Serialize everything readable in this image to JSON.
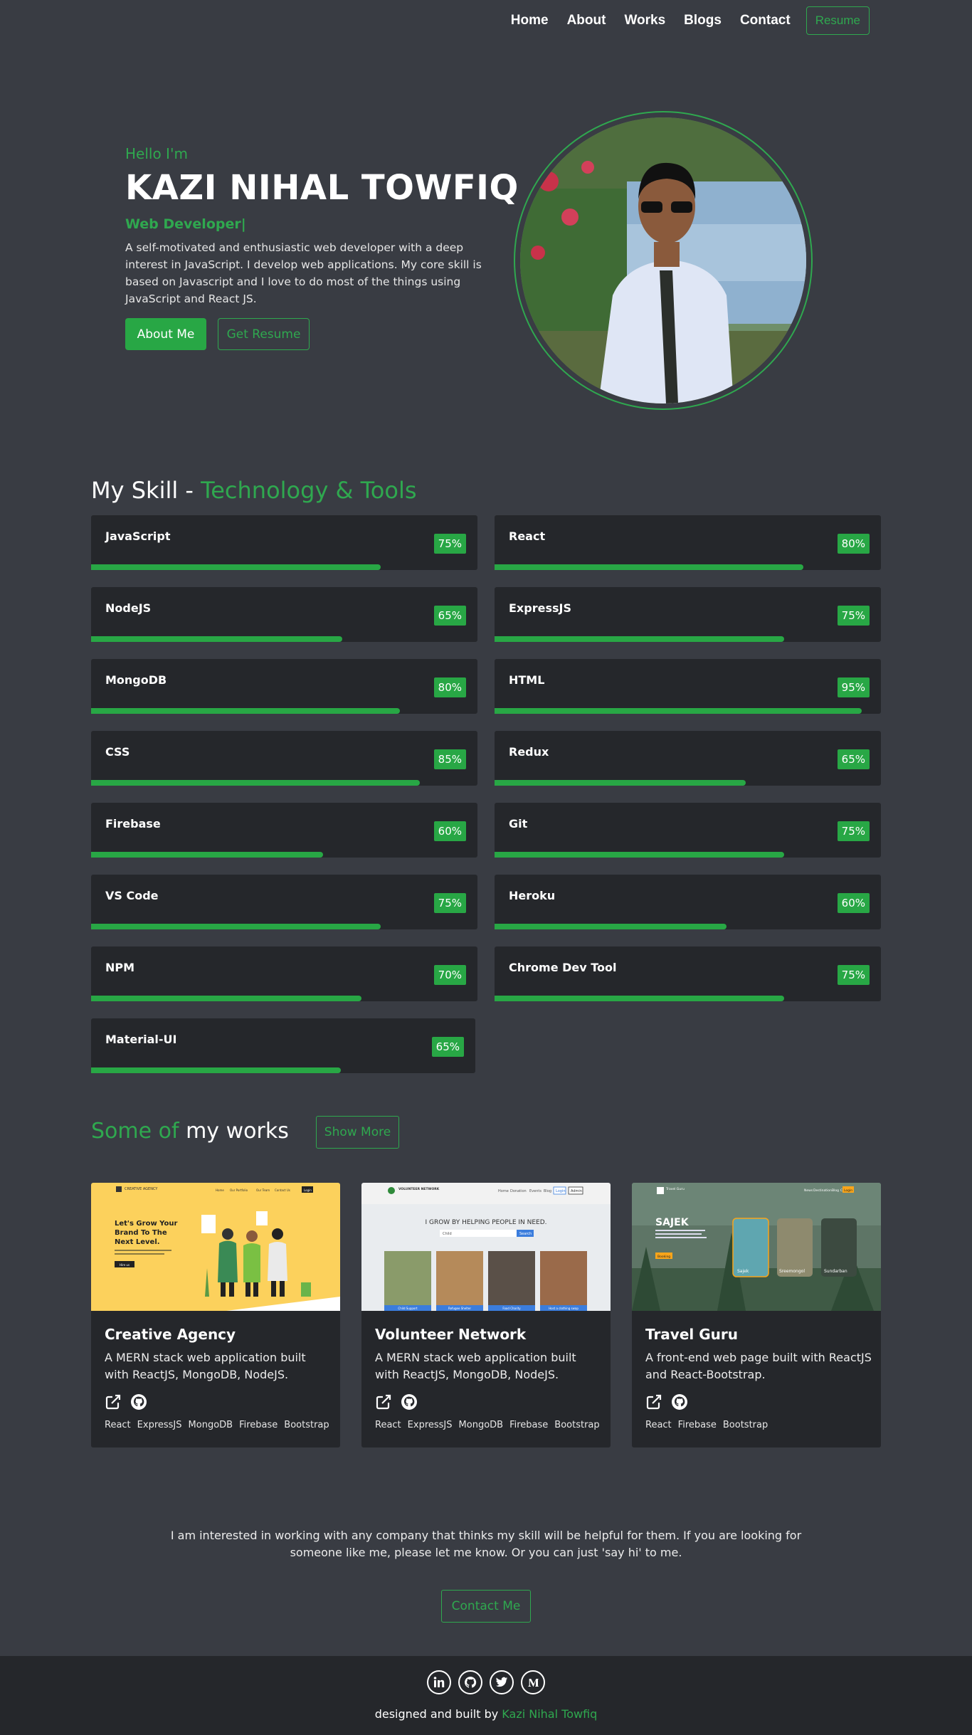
{
  "nav": {
    "items": [
      "Home",
      "About",
      "Works",
      "Blogs",
      "Contact"
    ],
    "resume_label": "Resume"
  },
  "hero": {
    "greeting": "Hello I'm",
    "name": "KAZI NIHAL TOWFIQ",
    "role": "Web Developer|",
    "description": "A self-motivated and enthusiastic web developer with a deep interest in JavaScript. I develop web applications. My core skill is based on Javascript and I love to do most of the things using JavaScript and React JS.",
    "about_button": "About Me",
    "resume_button": "Get Resume"
  },
  "skills": {
    "title_white": "My Skill - ",
    "title_green": "Technology & Tools",
    "items": [
      {
        "name": "JavaScript",
        "label": "75%",
        "value": 75
      },
      {
        "name": "React",
        "label": "80%",
        "value": 80
      },
      {
        "name": "NodeJS",
        "label": "65%",
        "value": 65
      },
      {
        "name": "ExpressJS",
        "label": "75%",
        "value": 75
      },
      {
        "name": "MongoDB",
        "label": "80%",
        "value": 80
      },
      {
        "name": "HTML",
        "label": "95%",
        "value": 95
      },
      {
        "name": "CSS",
        "label": "85%",
        "value": 85
      },
      {
        "name": "Redux",
        "label": "65%",
        "value": 65
      },
      {
        "name": "Firebase",
        "label": "60%",
        "value": 60
      },
      {
        "name": "Git",
        "label": "75%",
        "value": 75
      },
      {
        "name": "VS Code",
        "label": "75%",
        "value": 75
      },
      {
        "name": "Heroku",
        "label": "60%",
        "value": 60
      },
      {
        "name": "NPM",
        "label": "70%",
        "value": 70
      },
      {
        "name": "Chrome Dev Tool",
        "label": "75%",
        "value": 75
      },
      {
        "name": "Material-UI",
        "label": "65%",
        "value": 65
      }
    ]
  },
  "works": {
    "title_green": "Some of ",
    "title_white": "my works",
    "show_more": "Show More",
    "projects": [
      {
        "title": "Creative Agency",
        "description": "A MERN stack web application built with ReactJS, MongoDB, NodeJS.",
        "tags": [
          "React",
          "ExpressJS",
          "MongoDB",
          "Firebase",
          "Bootstrap"
        ],
        "thumb": {
          "brand": "CREATIVE AGENCY",
          "nav": [
            "Home",
            "Our Portfolio",
            "Our Team",
            "Contact Us",
            "Login"
          ],
          "headline": [
            "Let's Grow Your",
            "Brand To The",
            "Next Level."
          ],
          "button": "Hire us"
        }
      },
      {
        "title": "Volunteer Network",
        "description": "A MERN stack web application built with ReactJS, MongoDB, NodeJS.",
        "tags": [
          "React",
          "ExpressJS",
          "MongoDB",
          "Firebase",
          "Bootstrap"
        ],
        "thumb": {
          "brand": "VOLUNTEER NETWORK",
          "nav": [
            "Home",
            "Donation",
            "Events",
            "Blog"
          ],
          "login": "Login",
          "admin": "Admin",
          "headline": "I GROW BY HELPING PEOPLE IN NEED.",
          "search_value": "Child",
          "search_button": "Search",
          "cards": [
            "Child Support",
            "Refugee Shelter",
            "Food Charity",
            "Host a clothing swap"
          ]
        }
      },
      {
        "title": "Travel Guru",
        "description": "A front-end web page built with ReactJS and React-Bootstrap.",
        "tags": [
          "React",
          "Firebase",
          "Bootstrap"
        ],
        "thumb": {
          "brand": "Travel Guru",
          "nav": [
            "News",
            "Destination",
            "Blog",
            "Contact"
          ],
          "login": "Login",
          "headline": "SAJEK",
          "button": "Booking",
          "cards": [
            "Sajek",
            "Sreemongol",
            "Sundarban"
          ]
        }
      }
    ]
  },
  "cta": {
    "text": "I am interested in working with any company that thinks my skill will be helpful for them. If you are looking for someone like me, please let me know. Or you can just 'say hi' to me.",
    "button": "Contact Me"
  },
  "footer": {
    "credit_prefix": "designed and built by ",
    "credit_name": "Kazi Nihal Towfiq",
    "social_icons": [
      "linkedin-icon",
      "github-icon",
      "twitter-icon",
      "medium-icon"
    ]
  },
  "colors": {
    "background": "#393c43",
    "card": "#25272b",
    "accent": "#28a745"
  }
}
